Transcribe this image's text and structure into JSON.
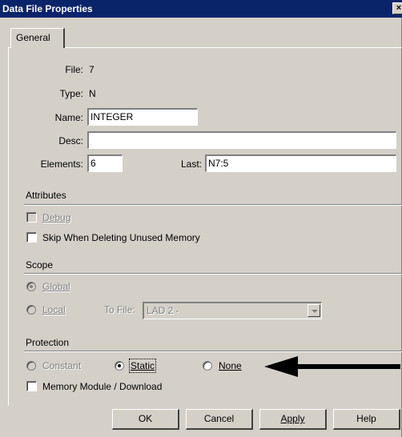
{
  "window": {
    "title": "Data File Properties",
    "close_glyph": "×"
  },
  "tabs": [
    {
      "label": "General",
      "active": true
    }
  ],
  "file": {
    "label": "File:",
    "value": "7"
  },
  "type": {
    "label": "Type:",
    "value": "N"
  },
  "name": {
    "label": "Name:",
    "value": "INTEGER"
  },
  "desc": {
    "label": "Desc:",
    "value": ""
  },
  "elements": {
    "label": "Elements:",
    "value": "6"
  },
  "last": {
    "label": "Last:",
    "value": "N7:5"
  },
  "attributes": {
    "heading": "Attributes",
    "debug": {
      "label": "Debug",
      "checked": false,
      "enabled": false
    },
    "skip_unused": {
      "label": "Skip When Deleting Unused Memory",
      "checked": false,
      "enabled": true
    }
  },
  "scope": {
    "heading": "Scope",
    "global": {
      "label": "Global",
      "selected": true,
      "enabled": false
    },
    "local": {
      "label": "Local",
      "selected": false,
      "enabled": false
    },
    "to_file": {
      "label": "To File:",
      "value": "LAD 2 -",
      "enabled": false
    }
  },
  "protection": {
    "heading": "Protection",
    "constant": {
      "label": "Constant",
      "selected": false,
      "enabled": false
    },
    "static": {
      "label": "Static",
      "selected": true,
      "enabled": true
    },
    "none": {
      "label": "None",
      "selected": false,
      "enabled": true
    },
    "memory_module": {
      "label": "Memory Module / Download",
      "checked": false
    }
  },
  "buttons": {
    "ok": "OK",
    "cancel": "Cancel",
    "apply": "Apply",
    "help": "Help"
  },
  "annotation": {
    "icon": "left-arrow-icon",
    "color": "#000000"
  },
  "colors": {
    "titlebar": "#0a246a",
    "face": "#d4d0c8",
    "disabled_text": "#808080"
  }
}
